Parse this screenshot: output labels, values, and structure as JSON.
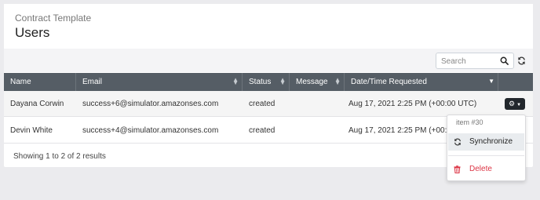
{
  "header": {
    "subtitle": "Contract Template",
    "title": "Users"
  },
  "toolbar": {
    "search_placeholder": "Search",
    "search_icon": "search-icon",
    "refresh_icon": "refresh-icon"
  },
  "table": {
    "columns": [
      {
        "label": "Name",
        "sortable": false
      },
      {
        "label": "Email",
        "sortable": true
      },
      {
        "label": "Status",
        "sortable": true
      },
      {
        "label": "Message",
        "sortable": true
      },
      {
        "label": "Date/Time Requested",
        "sortable": true,
        "sort_direction": "desc"
      }
    ],
    "rows": [
      {
        "name": "Dayana Corwin",
        "email": "success+6@simulator.amazonses.com",
        "status": "created",
        "message": "",
        "requested": "Aug 17, 2021 2:25 PM (+00:00 UTC)"
      },
      {
        "name": "Devin White",
        "email": "success+4@simulator.amazonses.com",
        "status": "created",
        "message": "",
        "requested": "Aug 17, 2021 2:25 PM (+00:00 UTC)"
      }
    ],
    "footer": "Showing 1 to 2 of 2 results"
  },
  "row_menu": {
    "button_icon": "gear-icon",
    "header": "item #30",
    "items": [
      {
        "label": "Synchronize",
        "icon": "sync-icon"
      },
      {
        "label": "Delete",
        "icon": "trash-icon",
        "color": "#dc3545"
      }
    ]
  },
  "colors": {
    "table_header": "#555d65",
    "page_background": "#ebebee",
    "danger": "#dc3545"
  }
}
